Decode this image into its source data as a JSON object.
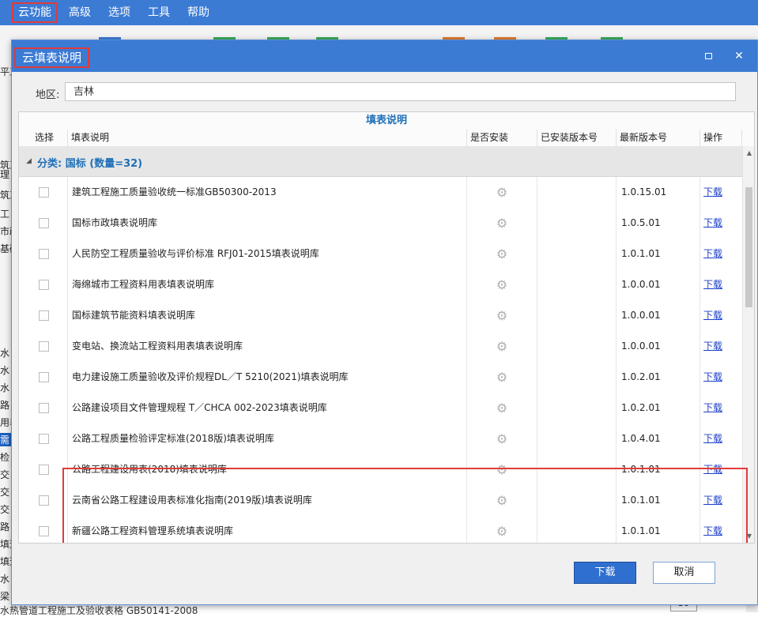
{
  "menu": [
    "云功能",
    "高级",
    "选项",
    "工具",
    "帮助"
  ],
  "background": {
    "left_fragments": [
      "平工",
      "理",
      "筑工",
      "筑工",
      "筑工",
      "工",
      "市政",
      "基础",
      "水",
      "水",
      "水",
      "路",
      "用表",
      "需",
      "检",
      "交",
      "交",
      "交",
      "路",
      "填道",
      "填道",
      "水",
      "梁"
    ],
    "bottom_text": "水热管道工程施工及验收表格 GB50141-2008",
    "number_box": "30"
  },
  "dialog": {
    "title": "云填表说明",
    "region_label": "地区:",
    "region_value": "吉林",
    "group_header": "填表说明",
    "columns": [
      "选择",
      "填表说明",
      "是否安装",
      "已安装版本号",
      "最新版本号",
      "操作"
    ],
    "category": "分类: 国标 (数量=32)",
    "rows": [
      {
        "name": "建筑工程施工质量验收统一标准GB50300-2013",
        "version": "1.0.15.01",
        "action": "下载"
      },
      {
        "name": "国标市政填表说明库",
        "version": "1.0.5.01",
        "action": "下载"
      },
      {
        "name": "人民防空工程质量验收与评价标准 RFJ01-2015填表说明库",
        "version": "1.0.1.01",
        "action": "下载"
      },
      {
        "name": "海绵城市工程资料用表填表说明库",
        "version": "1.0.0.01",
        "action": "下载"
      },
      {
        "name": "国标建筑节能资料填表说明库",
        "version": "1.0.0.01",
        "action": "下载"
      },
      {
        "name": "变电站、换流站工程资料用表填表说明库",
        "version": "1.0.0.01",
        "action": "下载"
      },
      {
        "name": "电力建设施工质量验收及评价规程DL／T 5210(2021)填表说明库",
        "version": "1.0.2.01",
        "action": "下载"
      },
      {
        "name": "公路建设项目文件管理规程 T／CHCA 002-2023填表说明库",
        "version": "1.0.2.01",
        "action": "下载"
      },
      {
        "name": "公路工程质量检验评定标准(2018版)填表说明库",
        "version": "1.0.4.01",
        "action": "下载"
      },
      {
        "name": "公路工程建设用表(2018)填表说明库",
        "version": "1.0.1.01",
        "action": "下载"
      },
      {
        "name": "云南省公路工程建设用表标准化指南(2019版)填表说明库",
        "version": "1.0.1.01",
        "action": "下载"
      },
      {
        "name": "新疆公路工程资料管理系统填表说明库",
        "version": "1.0.1.01",
        "action": "下载"
      }
    ],
    "buttons": {
      "download": "下载",
      "cancel": "取消"
    }
  },
  "colors": {
    "accent": "#3b7bd4",
    "highlight": "#e03b3b",
    "link": "#1c3fc9"
  }
}
